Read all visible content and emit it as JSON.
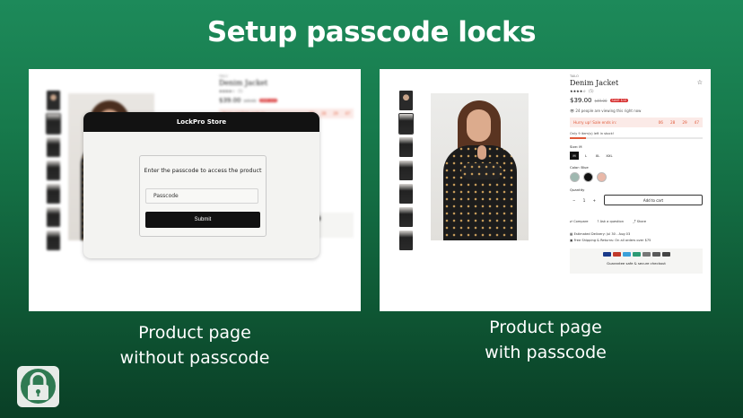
{
  "headline": "Setup passcode locks",
  "captions": {
    "left": [
      "Product page",
      "without passcode"
    ],
    "right": [
      "Product page",
      "with passcode"
    ]
  },
  "modal": {
    "store_name": "LockPro Store",
    "message": "Enter the passcode to access the product",
    "input_placeholder": "Passcode",
    "submit_label": "Submit"
  },
  "product": {
    "brand": "TAILO",
    "title": "Denim Jacket",
    "stars": "★★★★☆",
    "review_count": "(5)",
    "price": "$39.00",
    "old_price": "$49.00",
    "save_badge": "SAVE $10",
    "viewing": "24 people are viewing this right now",
    "hurry_text": "Hurry up! Sale ends in:",
    "countdown": [
      "06",
      "28",
      "29",
      "47"
    ],
    "stock": "Only 9 item(s) left in stock!",
    "stock_fraction": 0.12,
    "size_label": "Size: M",
    "sizes": [
      "M",
      "L",
      "XL",
      "XXL"
    ],
    "color_label": "Color: Blue",
    "colors": [
      "#9fb8b0",
      "#111111",
      "#e9b8a8"
    ],
    "quantity_label": "Quantity",
    "quantity": "1",
    "qty_minus": "−",
    "qty_plus": "+",
    "add_to_cart": "Add to cart",
    "actions": [
      "Compare",
      "Ask a question",
      "Share"
    ],
    "delivery": "Estimated Delivery: Jul 30 - Aug 03",
    "shipping": "Free Shipping & Returns: On all orders over $75",
    "payment_colors": [
      "#1a3a8a",
      "#c0392b",
      "#3aa0d9",
      "#2c9a74",
      "#777777",
      "#5a5a5a",
      "#444444"
    ],
    "guarantee": "Guarantee safe & secure checkout"
  }
}
